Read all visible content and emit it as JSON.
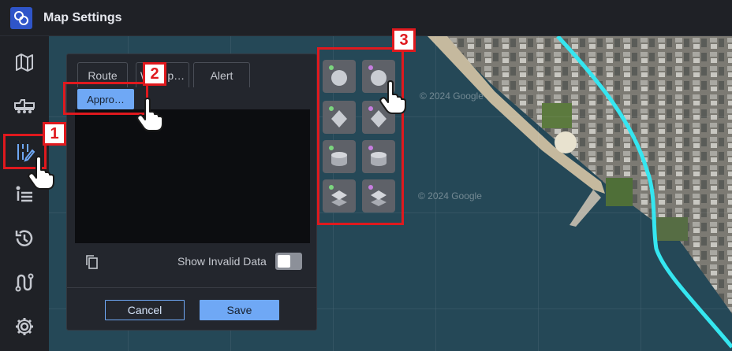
{
  "app": {
    "title": "Map Settings"
  },
  "nav": {
    "items": [
      {
        "icon": "map-icon"
      },
      {
        "icon": "truck-icon"
      },
      {
        "icon": "settings-sliders-icon"
      },
      {
        "icon": "list-icon"
      },
      {
        "icon": "history-icon"
      },
      {
        "icon": "route-icon"
      },
      {
        "icon": "gear-icon"
      }
    ]
  },
  "panel": {
    "tabs": [
      "Route",
      "Wa…p…",
      "Alert"
    ],
    "subtab_label": "Appro…",
    "show_invalid_label": "Show Invalid Data",
    "show_invalid_on": false,
    "cancel_label": "Cancel",
    "save_label": "Save"
  },
  "map": {
    "watermarks": [
      "© 2024 Google",
      "© 2024 Google"
    ],
    "route_color": "#35e6f0"
  },
  "icon_grid": {
    "cells": [
      {
        "shape": "circle",
        "dot": "#7bd67e"
      },
      {
        "shape": "circle",
        "dot": "#c77ee0"
      },
      {
        "shape": "diamond",
        "dot": "#7bd67e"
      },
      {
        "shape": "diamond",
        "dot": "#c77ee0"
      },
      {
        "shape": "cylinder",
        "dot": "#7bd67e"
      },
      {
        "shape": "cylinder",
        "dot": "#c77ee0"
      },
      {
        "shape": "layers",
        "dot": "#7bd67e"
      },
      {
        "shape": "layers",
        "dot": "#c77ee0"
      }
    ]
  },
  "annotations": [
    "1",
    "2",
    "3"
  ],
  "colors": {
    "accent": "#6fa8f5",
    "annotation": "#e0191e"
  }
}
